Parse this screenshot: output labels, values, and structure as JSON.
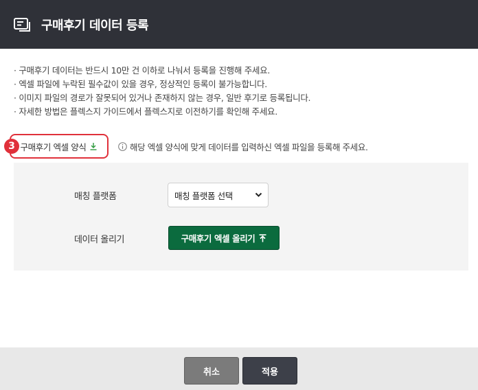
{
  "header": {
    "title": "구매후기 데이터 등록",
    "icon": "list-card-icon"
  },
  "notes": [
    "· 구매후기 데이터는 반드시 10만 건 이하로 나눠서 등록을 진행해 주세요.",
    "· 엑셀 파일에 누락된 필수값이 있을 경우, 정상적인 등록이 불가능합니다.",
    "· 이미지 파일의 경로가 잘못되어 있거나 존재하지 않는 경우, 일반 후기로 등록됩니다.",
    "· 자세한 방법은 플렉스지 가이드에서 플렉스지로 이전하기를 확인해 주세요."
  ],
  "template": {
    "button_label": "구매후기 엑셀 양식",
    "step_badge": "3",
    "hint": "해당 엑셀 양식에 맞게 데이터를 입력하신 엑셀 파일을 등록해 주세요."
  },
  "form": {
    "platform_label": "매칭 플랫폼",
    "platform_select": "매칭 플랫폼 선택",
    "upload_label": "데이터 올리기",
    "upload_button": "구매후기 엑셀 올리기"
  },
  "footer": {
    "cancel": "취소",
    "apply": "적용"
  },
  "colors": {
    "header_bg": "#2f3138",
    "accent_red": "#e0303a",
    "upload_green": "#0b6b3e",
    "cancel_gray": "#7b7b7b",
    "apply_dark": "#3d4049"
  }
}
